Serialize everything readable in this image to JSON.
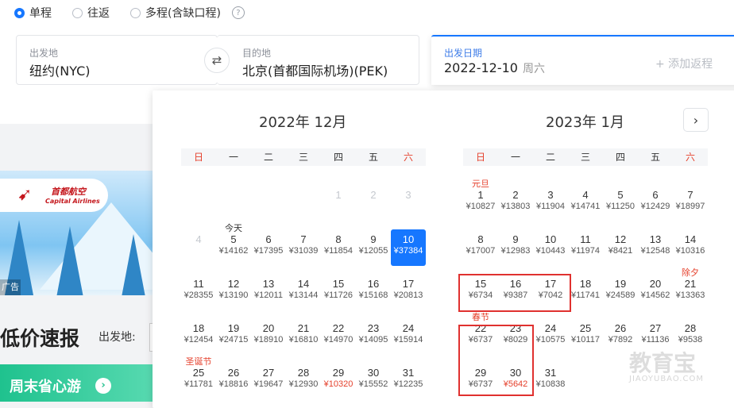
{
  "trip_type": {
    "options": [
      {
        "label": "单程",
        "selected": true
      },
      {
        "label": "往返",
        "selected": false
      },
      {
        "label": "多程(含缺口程)",
        "selected": false
      }
    ],
    "help_glyph": "?"
  },
  "search": {
    "from_label": "出发地",
    "from_value": "纽约(NYC)",
    "to_label": "目的地",
    "to_value": "北京(首都国际机场)(PEK)",
    "swap_icon": "swap-icon",
    "swap_glyph": "⇄",
    "date_label": "出发日期",
    "date_value": "2022-12-10",
    "date_weekday": "周六",
    "add_return": "+ 添加返程"
  },
  "promo": {
    "airline_cn": "首都航空",
    "airline_en": "Capital Airlines",
    "ad_label": "广告",
    "deals_title": "低价速报",
    "deals_from_label": "出发地:",
    "weekend_label": "周末省心游",
    "weekend_arrow": "›"
  },
  "calendar": {
    "next_glyph": "›",
    "weekdays": [
      "日",
      "一",
      "二",
      "三",
      "四",
      "五",
      "六"
    ],
    "accent_color": "#1677ff",
    "holiday_color": "#e5402c",
    "months": [
      {
        "title": "2022年 12月",
        "start_weekday": 0,
        "weeks": [
          [
            null,
            null,
            null,
            null,
            {
              "d": "1",
              "past": true
            },
            {
              "d": "2",
              "past": true
            },
            {
              "d": "3",
              "past": true
            }
          ],
          [
            {
              "d": "4",
              "past": true
            },
            {
              "d": "5",
              "p": "¥14162",
              "tag": "今天",
              "tagToday": true
            },
            {
              "d": "6",
              "p": "¥17395"
            },
            {
              "d": "7",
              "p": "¥31039"
            },
            {
              "d": "8",
              "p": "¥11854"
            },
            {
              "d": "9",
              "p": "¥12055"
            },
            {
              "d": "10",
              "p": "¥37384",
              "selected": true
            }
          ],
          [
            {
              "d": "11",
              "p": "¥28355"
            },
            {
              "d": "12",
              "p": "¥13190"
            },
            {
              "d": "13",
              "p": "¥12011"
            },
            {
              "d": "14",
              "p": "¥13144"
            },
            {
              "d": "15",
              "p": "¥11726"
            },
            {
              "d": "16",
              "p": "¥15168"
            },
            {
              "d": "17",
              "p": "¥20813"
            }
          ],
          [
            {
              "d": "18",
              "p": "¥12454"
            },
            {
              "d": "19",
              "p": "¥24715"
            },
            {
              "d": "20",
              "p": "¥18910"
            },
            {
              "d": "21",
              "p": "¥16810"
            },
            {
              "d": "22",
              "p": "¥14970"
            },
            {
              "d": "23",
              "p": "¥14095"
            },
            {
              "d": "24",
              "p": "¥15914"
            }
          ],
          [
            {
              "d": "25",
              "p": "¥11781",
              "tag": "圣诞节"
            },
            {
              "d": "26",
              "p": "¥18816"
            },
            {
              "d": "27",
              "p": "¥19647"
            },
            {
              "d": "28",
              "p": "¥12930"
            },
            {
              "d": "29",
              "p": "¥10320",
              "low": true
            },
            {
              "d": "30",
              "p": "¥15552"
            },
            {
              "d": "31",
              "p": "¥12235"
            }
          ]
        ]
      },
      {
        "title": "2023年 1月",
        "weeks": [
          [
            {
              "d": "1",
              "p": "¥10827",
              "tag": "元旦"
            },
            {
              "d": "2",
              "p": "¥13803"
            },
            {
              "d": "3",
              "p": "¥11904"
            },
            {
              "d": "4",
              "p": "¥14741"
            },
            {
              "d": "5",
              "p": "¥11250"
            },
            {
              "d": "6",
              "p": "¥12429"
            },
            {
              "d": "7",
              "p": "¥18997"
            }
          ],
          [
            {
              "d": "8",
              "p": "¥17007"
            },
            {
              "d": "9",
              "p": "¥12983"
            },
            {
              "d": "10",
              "p": "¥10443"
            },
            {
              "d": "11",
              "p": "¥11974"
            },
            {
              "d": "12",
              "p": "¥8421"
            },
            {
              "d": "13",
              "p": "¥12548"
            },
            {
              "d": "14",
              "p": "¥10316"
            }
          ],
          [
            {
              "d": "15",
              "p": "¥6734"
            },
            {
              "d": "16",
              "p": "¥9387"
            },
            {
              "d": "17",
              "p": "¥7042"
            },
            {
              "d": "18",
              "p": "¥11741"
            },
            {
              "d": "19",
              "p": "¥24589"
            },
            {
              "d": "20",
              "p": "¥14562"
            },
            {
              "d": "21",
              "p": "¥13363",
              "tag": "除夕"
            }
          ],
          [
            {
              "d": "22",
              "p": "¥6737",
              "tag": "春节"
            },
            {
              "d": "23",
              "p": "¥8029"
            },
            {
              "d": "24",
              "p": "¥10575"
            },
            {
              "d": "25",
              "p": "¥10117"
            },
            {
              "d": "26",
              "p": "¥7892"
            },
            {
              "d": "27",
              "p": "¥11136"
            },
            {
              "d": "28",
              "p": "¥9538"
            }
          ],
          [
            {
              "d": "29",
              "p": "¥6737"
            },
            {
              "d": "30",
              "p": "¥5642",
              "low": true
            },
            {
              "d": "31",
              "p": "¥10838"
            },
            null,
            null,
            null,
            null
          ]
        ]
      }
    ]
  },
  "watermark": {
    "cn": "教育宝",
    "en": "JIAOYUBAO.COM"
  }
}
